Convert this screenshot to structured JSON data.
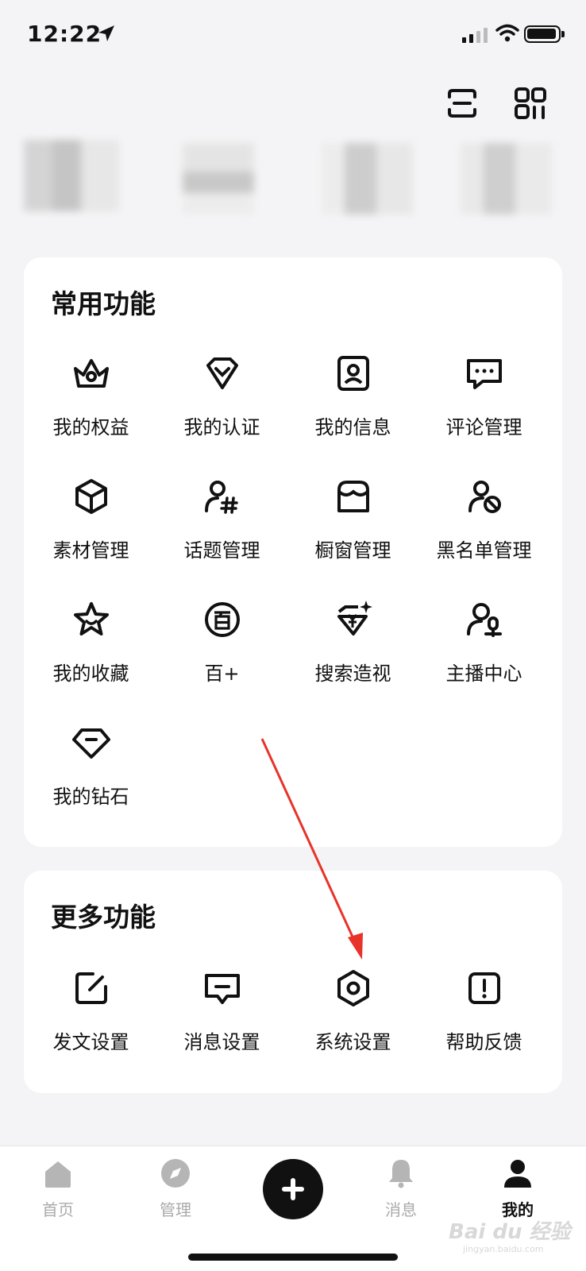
{
  "status_bar": {
    "time": "12:22"
  },
  "sections": [
    {
      "title": "常用功能",
      "items": [
        {
          "label": "我的权益",
          "icon": "crown-icon"
        },
        {
          "label": "我的认证",
          "icon": "verified-badge-icon"
        },
        {
          "label": "我的信息",
          "icon": "profile-card-icon"
        },
        {
          "label": "评论管理",
          "icon": "comment-icon"
        },
        {
          "label": "素材管理",
          "icon": "cube-icon"
        },
        {
          "label": "话题管理",
          "icon": "topic-hash-icon"
        },
        {
          "label": "橱窗管理",
          "icon": "shop-window-icon"
        },
        {
          "label": "黑名单管理",
          "icon": "block-user-icon"
        },
        {
          "label": "我的收藏",
          "icon": "star-icon"
        },
        {
          "label": "百+",
          "icon": "bai-plus-icon"
        },
        {
          "label": "搜索造视",
          "icon": "search-insight-icon"
        },
        {
          "label": "主播中心",
          "icon": "streamer-mic-icon"
        },
        {
          "label": "我的钻石",
          "icon": "diamond-icon"
        }
      ]
    },
    {
      "title": "更多功能",
      "items": [
        {
          "label": "发文设置",
          "icon": "edit-icon"
        },
        {
          "label": "消息设置",
          "icon": "message-icon"
        },
        {
          "label": "系统设置",
          "icon": "settings-hexagon-icon"
        },
        {
          "label": "帮助反馈",
          "icon": "help-feedback-icon"
        }
      ]
    }
  ],
  "tab_bar": {
    "tabs": [
      {
        "label": "首页",
        "icon": "home-icon"
      },
      {
        "label": "管理",
        "icon": "compass-icon"
      },
      {
        "label": "",
        "icon": "plus-icon"
      },
      {
        "label": "消息",
        "icon": "bell-icon"
      },
      {
        "label": "我的",
        "icon": "person-icon",
        "active": true
      }
    ]
  },
  "watermark": {
    "text": "Bai du 经验",
    "sub": "jingyan.baidu.com"
  }
}
